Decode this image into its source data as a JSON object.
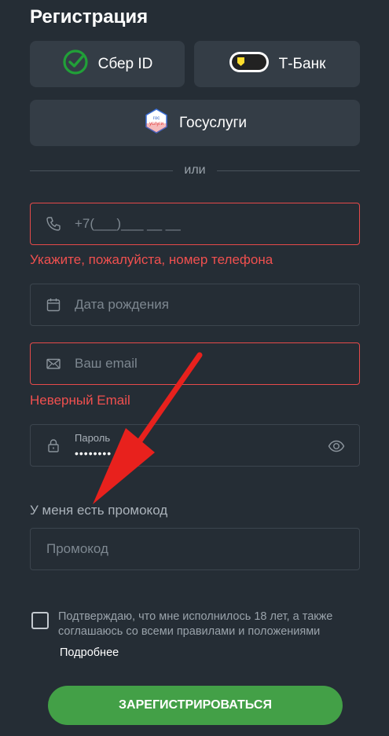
{
  "header": {
    "title": "Регистрация"
  },
  "social": {
    "sber_label": "Сбер ID",
    "tbank_label": "Т-Банк",
    "tbank_badge": "ID",
    "gos_label": "Госуслуги",
    "gos_logo_text": "гос услуги"
  },
  "divider": {
    "text": "или"
  },
  "phone": {
    "placeholder": "+7(___)___ __ __",
    "error": "Укажите, пожалуйста, номер телефона"
  },
  "dob": {
    "placeholder": "Дата рождения"
  },
  "email": {
    "placeholder": "Ваш email",
    "error": "Неверный Email"
  },
  "password": {
    "label": "Пароль",
    "value": "••••••••"
  },
  "promo": {
    "link": "У меня есть промокод",
    "placeholder": "Промокод"
  },
  "agreement": {
    "text": "Подтверждаю, что мне исполнилось 18 лет, а также соглашаюсь со всеми правилами и положениями",
    "more": "Подробнее",
    "checked": false
  },
  "submit": {
    "label": "ЗАРЕГИСТРИРОВАТЬСЯ"
  },
  "colors": {
    "background": "#252d35",
    "error": "#f0504f",
    "accent": "#43a047",
    "sber": "#21a038",
    "tbank_yellow": "#ffdd2d",
    "annotation_arrow": "#e8211d"
  }
}
